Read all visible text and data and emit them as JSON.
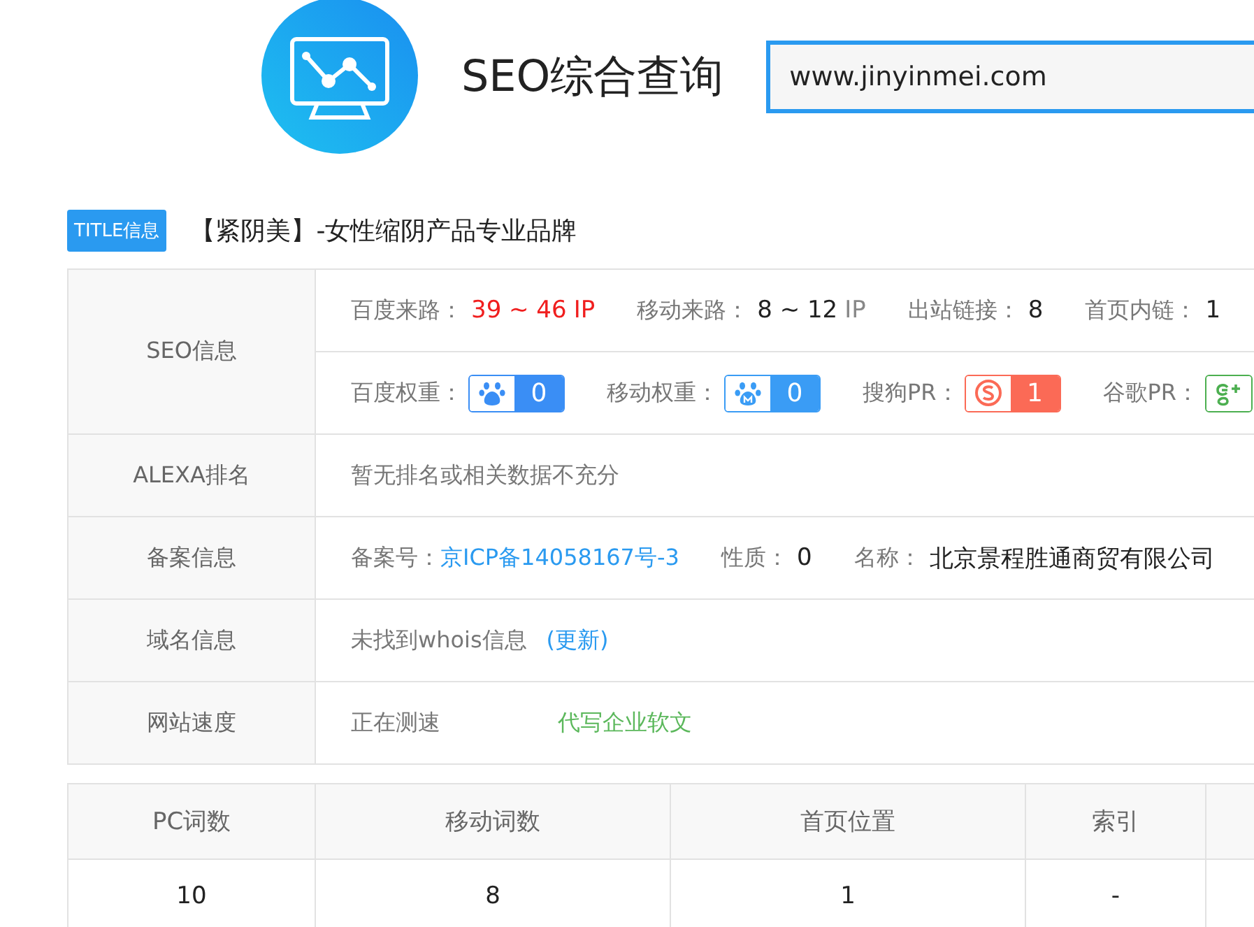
{
  "header": {
    "title": "SEO综合查询",
    "search": {
      "value": "www.jinyinmei.com"
    }
  },
  "title_info": {
    "badge": "TITLE信息",
    "text": "【紧阴美】-女性缩阴产品专业品牌"
  },
  "info_table": {
    "seo": {
      "label": "SEO信息",
      "traffic": [
        {
          "label": "百度来路：",
          "value": "39 ~ 46",
          "unit": "IP",
          "highlight": true
        },
        {
          "label": "移动来路：",
          "value": "8 ~ 12",
          "unit": "IP",
          "highlight": false
        },
        {
          "label": "出站链接：",
          "value": "8",
          "highlight": false
        },
        {
          "label": "首页内链：",
          "value": "1",
          "highlight": false
        }
      ],
      "weights": [
        {
          "label": "百度权重：",
          "kind": "baidu",
          "value": "0",
          "color": "#3a8ef5"
        },
        {
          "label": "移动权重：",
          "kind": "baidu_mobile",
          "value": "0",
          "color": "#3a9cf5"
        },
        {
          "label": "搜狗PR：",
          "kind": "sogou",
          "value": "1",
          "color": "#fb6a56"
        },
        {
          "label": "谷歌PR：",
          "kind": "google",
          "color": "#4caf50"
        }
      ]
    },
    "alexa": {
      "label": "ALEXA排名",
      "text": "暂无排名或相关数据不充分"
    },
    "icp": {
      "label": "备案信息",
      "number_label": "备案号：",
      "number": "京ICP备14058167号-3",
      "nature_label": "性质：",
      "nature": "0",
      "name_label": "名称：",
      "name": "北京景程胜通商贸有限公司"
    },
    "domain": {
      "label": "域名信息",
      "text": "未找到whois信息",
      "link": "(更新)"
    },
    "speed": {
      "label": "网站速度",
      "text": "正在测速",
      "ad": "代写企业软文"
    }
  },
  "keyword_table": {
    "columns": [
      "PC词数",
      "移动词数",
      "首页位置",
      "索引"
    ],
    "rows": [
      [
        "10",
        "8",
        "1",
        "-"
      ]
    ]
  }
}
